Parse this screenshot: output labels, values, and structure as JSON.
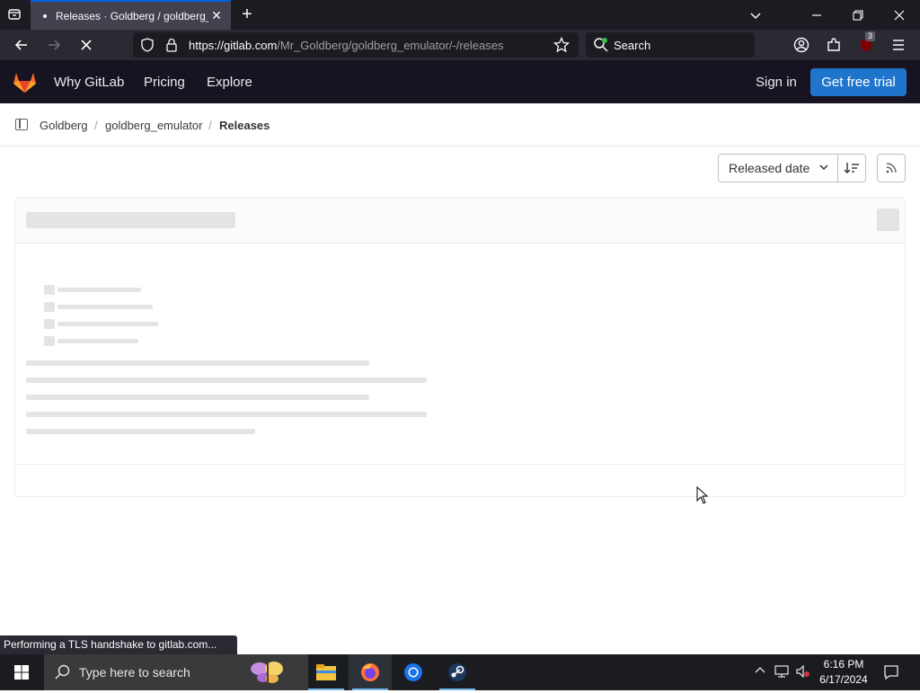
{
  "browser": {
    "tab_title": "Releases · Goldberg / goldberg_e",
    "url_host": "https://gitlab.com",
    "url_path": "/Mr_Goldberg/goldberg_emulator/-/releases",
    "search_placeholder": "Search",
    "extension_badge": "3",
    "status_text": "Performing a TLS handshake to gitlab.com..."
  },
  "gitlab_header": {
    "nav": [
      "Why GitLab",
      "Pricing",
      "Explore"
    ],
    "sign_in": "Sign in",
    "cta": "Get free trial"
  },
  "breadcrumb": {
    "items": [
      "Goldberg",
      "goldberg_emulator",
      "Releases"
    ],
    "separator": "/"
  },
  "sort": {
    "selected": "Released date"
  },
  "taskbar": {
    "search_placeholder": "Type here to search",
    "time": "6:16 PM",
    "date": "6/17/2024"
  },
  "colors": {
    "gitlab_header_bg": "#171321",
    "cta_blue": "#1f75cb",
    "skeleton": "#e4e4e7"
  }
}
